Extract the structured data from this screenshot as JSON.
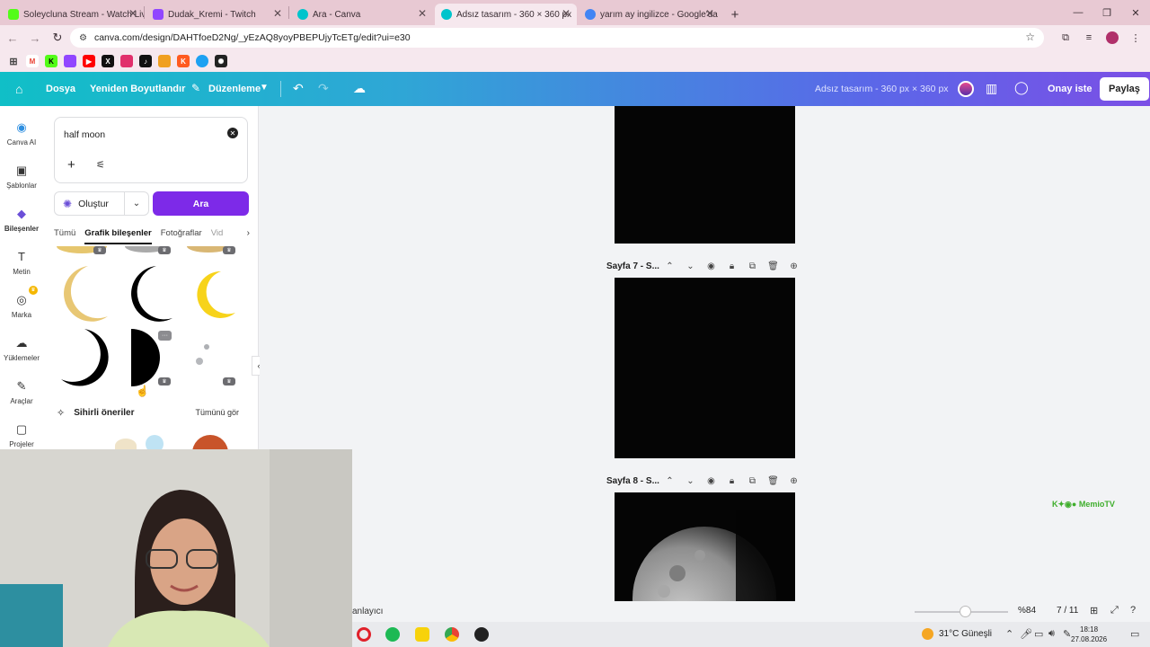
{
  "browser": {
    "tabs": [
      {
        "title": "Soleycluna Stream - Watch Live",
        "favicon_color": "#53fc18",
        "active": false
      },
      {
        "title": "Dudak_Kremi - Twitch",
        "favicon_color": "#9146ff",
        "active": false
      },
      {
        "title": "Ara - Canva",
        "favicon_color": "#00c4cc",
        "active": false
      },
      {
        "title": "Adsız tasarım - 360 × 360 px",
        "favicon_color": "#00c4cc",
        "active": true
      },
      {
        "title": "yarım ay ingilizce - Google'da",
        "favicon_color": "#4285f4",
        "active": false
      }
    ],
    "new_tab": "+",
    "url": "canva.com/design/DAHTfoeD2Ng/_yEzAQ8yoyPBEPUjyTcETg/edit?ui=e30",
    "bookmark_colors": [
      "#777777",
      "#ea4335",
      "#53fc18",
      "#9146ff",
      "#ff0000",
      "#111111",
      "#e1306c",
      "#111111",
      "#f0a020",
      "#ff5a1f",
      "#1da1f2",
      "#222222"
    ]
  },
  "canva": {
    "header": {
      "file": "Dosya",
      "resize": "Yeniden Boyutlandır",
      "edit": "Düzenleme",
      "design_title": "Adsız tasarım - 360 px × 360 px",
      "approve": "Onay iste",
      "share": "Paylaş"
    },
    "rail": [
      {
        "label": "Canva AI",
        "icon": "canva-ai-icon",
        "glyph": "◉"
      },
      {
        "label": "Şablonlar",
        "icon": "templates-icon",
        "glyph": "▣"
      },
      {
        "label": "Bileşenler",
        "icon": "elements-icon",
        "glyph": "◆",
        "active": true
      },
      {
        "label": "Metin",
        "icon": "text-icon",
        "glyph": "T"
      },
      {
        "label": "Marka",
        "icon": "brand-icon",
        "glyph": "◎"
      },
      {
        "label": "Yüklemeler",
        "icon": "uploads-icon",
        "glyph": "☁"
      },
      {
        "label": "Araçlar",
        "icon": "tools-icon",
        "glyph": "✎"
      },
      {
        "label": "Projeler",
        "icon": "projects-icon",
        "glyph": "▢"
      }
    ],
    "panel": {
      "search_query": "half moon",
      "create_label": "Oluştur",
      "search_button": "Ara",
      "filter_tabs": [
        "Tümü",
        "Grafik bileşenler",
        "Fotoğraflar",
        "Vid"
      ],
      "active_filter": "Grafik bileşenler",
      "magic_title": "Sihirli öneriler",
      "see_all": "Tümünü gör"
    },
    "pages": [
      {
        "label": "Sayfa 7 - S..."
      },
      {
        "label": "Sayfa 8 - S..."
      }
    ],
    "watermark": "K✦◉● MemioTV",
    "status": {
      "notes": "anlayıcı",
      "zoom": "%84",
      "zoom_level": 0.55,
      "page_count": "7 / 11"
    }
  },
  "taskbar": {
    "weather": "31°C  Güneşli",
    "time": "18:18",
    "date": "27.08.2026"
  }
}
